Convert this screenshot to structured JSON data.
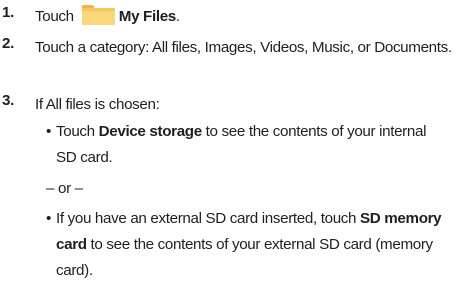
{
  "steps": [
    {
      "num": "1.",
      "pre": "Touch",
      "bold": "My Files",
      "post": "."
    },
    {
      "num": "2.",
      "text": "Touch a category: All files, Images, Videos, Music, or Documents."
    },
    {
      "num": "3.",
      "text": "If All files is chosen:"
    }
  ],
  "bullets": [
    {
      "pre": "Touch ",
      "bold": "Device storage",
      "post": " to see the contents of your internal SD card."
    },
    {
      "pre": "If you have an external SD card inserted, touch ",
      "bold": "SD memory card",
      "post": " to see the contents of your external SD card (memory card)."
    }
  ],
  "separator": "– or –",
  "bullet_glyph": "•",
  "icons": {
    "folder": "folder-icon"
  },
  "colors": {
    "folder": "#f6c65f",
    "text": "#1f1f1f"
  }
}
